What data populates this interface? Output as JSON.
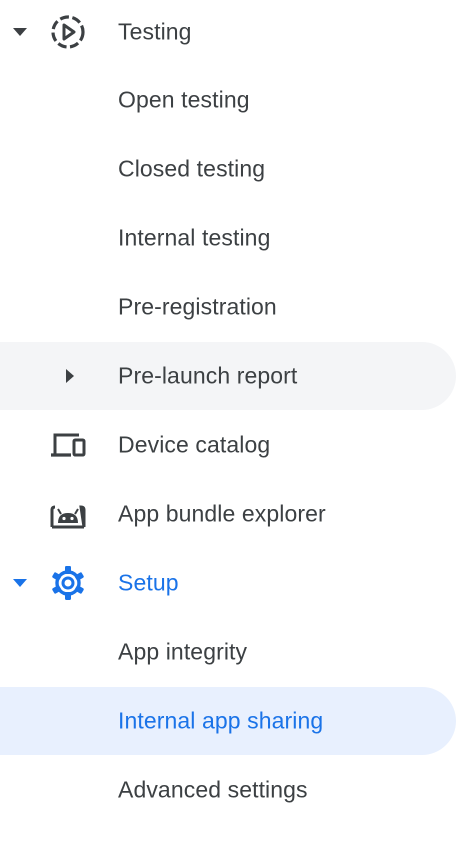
{
  "nav": {
    "testing": {
      "label": "Testing",
      "icon": "play-circle-dashed-icon",
      "expanded": true,
      "children": [
        {
          "label": "Open testing"
        },
        {
          "label": "Closed testing"
        },
        {
          "label": "Internal testing"
        },
        {
          "label": "Pre-registration"
        },
        {
          "label": "Pre-launch report",
          "expandable": true,
          "expanded": false
        }
      ]
    },
    "device_catalog": {
      "label": "Device catalog",
      "icon": "devices-icon"
    },
    "app_bundle_explorer": {
      "label": "App bundle explorer",
      "icon": "android-icon"
    },
    "setup": {
      "label": "Setup",
      "icon": "gear-icon",
      "expanded": true,
      "children": [
        {
          "label": "App integrity"
        },
        {
          "label": "Internal app sharing",
          "selected": true
        },
        {
          "label": "Advanced settings"
        }
      ]
    }
  },
  "colors": {
    "text": "#3c4043",
    "accent": "#1a73e8",
    "selected_bg": "#e8f0fe",
    "hover_bg": "#f4f5f7"
  }
}
